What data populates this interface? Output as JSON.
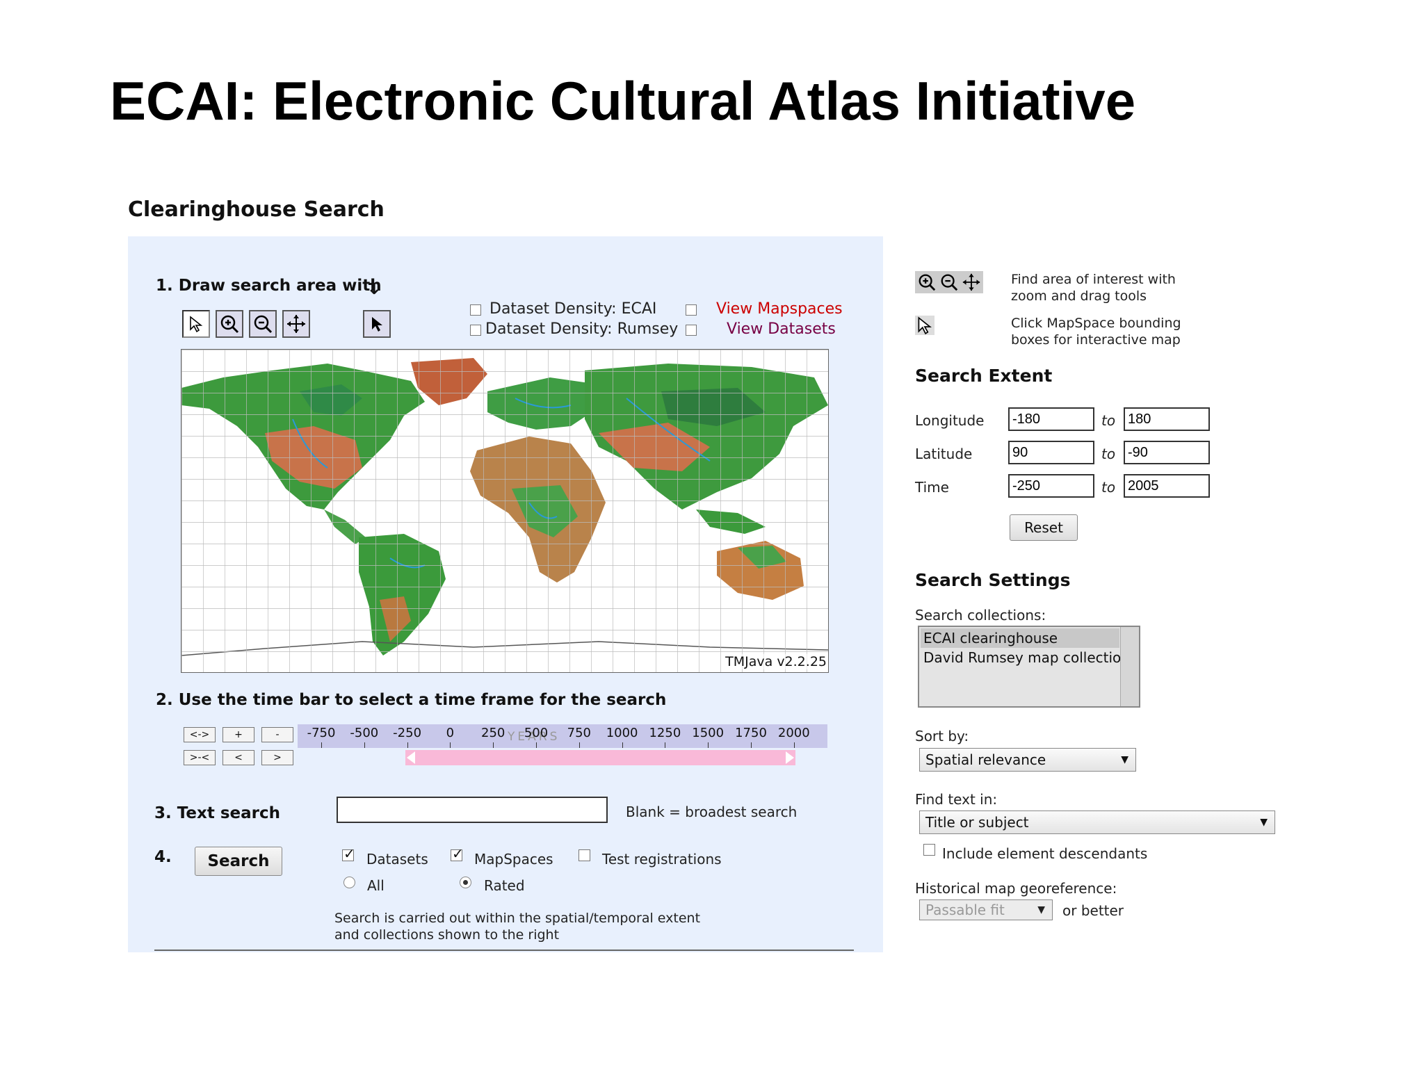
{
  "slide": {
    "title": "ECAI: Electronic Cultural Atlas Initiative"
  },
  "clearinghouse": {
    "title": "Clearinghouse Search",
    "step1": "1. Draw search area with",
    "density_ecai": "Dataset Density: ECAI",
    "density_rumsey": "Dataset Density: Rumsey",
    "view_mapspaces": "View Mapspaces",
    "view_datasets": "View Datasets",
    "map_version": "TMJava v2.2.25",
    "step2": "2. Use the time bar to select a time frame for the search",
    "time_buttons": [
      "<->",
      "+",
      "-",
      ">-<",
      "<",
      ">"
    ],
    "time_ticks": [
      "-750",
      "-500",
      "-250",
      "0",
      "250",
      "500",
      "750",
      "1000",
      "1250",
      "1500",
      "1750",
      "2000"
    ],
    "time_years_label": "YEARS",
    "time_selection": {
      "start_fraction": 0.204,
      "end_fraction": 0.94
    },
    "step3": "3. Text search",
    "text_value": "",
    "blank_hint": "Blank = broadest search",
    "step4": "4.",
    "search_button": "Search",
    "opt_datasets": "Datasets",
    "opt_mapspaces": "MapSpaces",
    "opt_test": "Test registrations",
    "opt_all": "All",
    "opt_rated": "Rated",
    "note_line1": "Search is carried out within the spatial/temporal extent",
    "note_line2": "and collections shown to the right"
  },
  "right": {
    "help1_line1": "Find area of interest with",
    "help1_line2": "zoom and drag tools",
    "help2_line1": "Click MapSpace bounding",
    "help2_line2": "boxes for interactive map",
    "extent_title": "Search Extent",
    "longitude_label": "Longitude",
    "latitude_label": "Latitude",
    "time_label": "Time",
    "to": "to",
    "lon_from": "-180",
    "lon_to": "180",
    "lat_from": "90",
    "lat_to": "-90",
    "time_from": "-250",
    "time_to": "2005",
    "reset": "Reset",
    "settings_title": "Search Settings",
    "collections_label": "Search collections:",
    "collections": [
      "ECAI clearinghouse",
      "David Rumsey map collection"
    ],
    "sort_label": "Sort by:",
    "sort_value": "Spatial relevance",
    "find_label": "Find text in:",
    "find_value": "Title or subject",
    "include_desc": "Include element descendants",
    "hist_label": "Historical map georeference:",
    "hist_value": "Passable fit",
    "or_better": "or better"
  },
  "colors": {
    "panel_bg": "#e8f0fd",
    "time_bar": "#c8c8ea",
    "time_selection": "#f9b9d8",
    "mapspaces_link": "#cc0000",
    "datasets_link": "#770044"
  }
}
